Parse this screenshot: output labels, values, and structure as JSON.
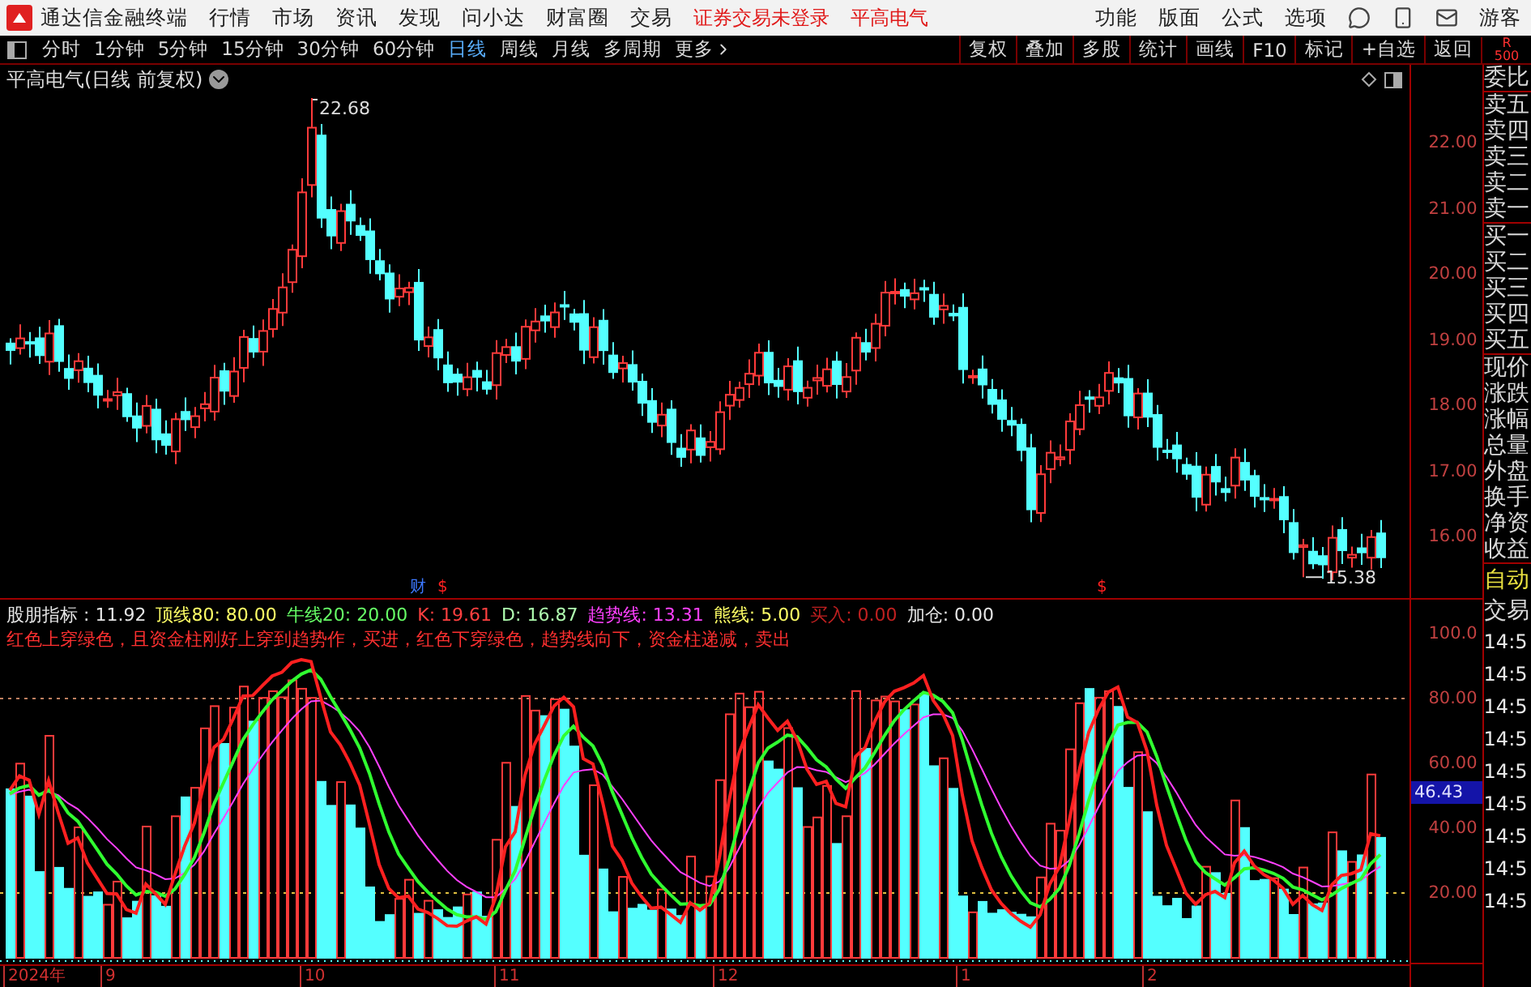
{
  "app": {
    "title": "通达信金融终端"
  },
  "menu": [
    "行情",
    "市场",
    "资讯",
    "发现",
    "问小达",
    "财富圈",
    "交易"
  ],
  "status": [
    "证券交易未登录",
    "平高电气"
  ],
  "right_menu": [
    "功能",
    "版面",
    "公式",
    "选项"
  ],
  "user": "游客",
  "periods": [
    {
      "label": "分时",
      "selected": false
    },
    {
      "label": "1分钟",
      "selected": false
    },
    {
      "label": "5分钟",
      "selected": false
    },
    {
      "label": "15分钟",
      "selected": false
    },
    {
      "label": "30分钟",
      "selected": false
    },
    {
      "label": "60分钟",
      "selected": false
    },
    {
      "label": "日线",
      "selected": true
    },
    {
      "label": "周线",
      "selected": false
    },
    {
      "label": "月线",
      "selected": false
    },
    {
      "label": "多周期",
      "selected": false
    },
    {
      "label": "更多",
      "selected": false
    }
  ],
  "tools": [
    "复权",
    "叠加",
    "多股",
    "统计",
    "画线",
    "F10",
    "标记",
    "+自选",
    "返回"
  ],
  "corner": [
    "R",
    "500"
  ],
  "price_chart": {
    "title": "平高电气(日线 前复权)",
    "high_label": "22.68",
    "low_label": "15.38",
    "markers": [
      {
        "text": "财",
        "color": "#3c78ff"
      },
      {
        "text": "$",
        "color": "#ff2020"
      },
      {
        "text": "$",
        "color": "#ff2020"
      }
    ]
  },
  "price_axis": [
    "22.00",
    "21.00",
    "20.00",
    "19.00",
    "18.00",
    "17.00",
    "16.00"
  ],
  "indicator": {
    "legend": [
      {
        "text": "股朋指标 : 11.92",
        "color": "#e6e6e6"
      },
      {
        "text": "顶线80: 80.00",
        "color": "#ffff66"
      },
      {
        "text": "牛线20: 20.00",
        "color": "#66ff66"
      },
      {
        "text": "K: 19.61",
        "color": "#ff4040"
      },
      {
        "text": "D: 16.87",
        "color": "#b0ffb0"
      },
      {
        "text": "趋势线: 13.31",
        "color": "#ff40ff"
      },
      {
        "text": "熊线: 5.00",
        "color": "#ffff66"
      },
      {
        "text": "买入: 0.00",
        "color": "#c02020"
      },
      {
        "text": "加仓: 0.00",
        "color": "#e6e6e6"
      }
    ],
    "description": "红色上穿绿色，且资金柱刚好上穿到趋势作，买进，红色下穿绿色，趋势线向下，资金柱递减，卖出"
  },
  "indicator_axis": [
    "100.0",
    "80.00",
    "60.00",
    "40.00",
    "20.00"
  ],
  "current_value": "46.43",
  "date_axis": [
    "2024年",
    "9",
    "10",
    "11",
    "12",
    "1",
    "2"
  ],
  "quote_panel": [
    [
      "委比"
    ],
    [
      "卖五",
      "卖四",
      "卖三",
      "卖二",
      "卖一"
    ],
    [
      "买一",
      "买二",
      "买三",
      "买四",
      "买五"
    ],
    [
      "现价",
      "涨跌",
      "涨幅",
      "总量",
      "外盘",
      "换手",
      "净资",
      "收益"
    ]
  ],
  "trade": {
    "auto": "自动",
    "label": "交易",
    "times": [
      "14:5",
      "14:5",
      "14:5",
      "14:5",
      "14:5",
      "14:5",
      "14:5",
      "14:5",
      "14:5"
    ]
  }
}
